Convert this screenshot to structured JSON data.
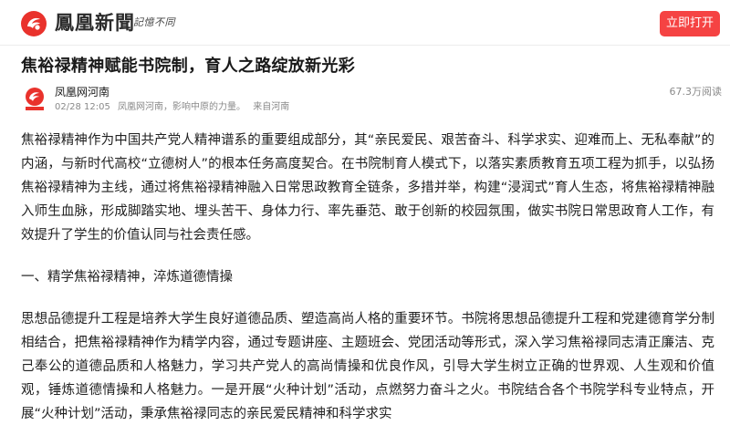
{
  "header": {
    "brand": "鳳凰新聞",
    "slogan": "記憶不同",
    "open_button": "立即打开"
  },
  "article": {
    "title": "焦裕禄精神赋能书院制，育人之路绽放新光彩",
    "author": "凤凰网河南",
    "date": "02/28 12:05",
    "source_desc": "凤凰网河南，影响中原的力量。",
    "origin": "来自河南",
    "reads": "67.3万阅读",
    "paragraph1": "焦裕禄精神作为中国共产党人精神谱系的重要组成部分，其“亲民爱民、艰苦奋斗、科学求实、迎难而上、无私奉献”的内涵，与新时代高校“立德树人”的根本任务高度契合。在书院制育人模式下，以落实素质教育五项工程为抓手，以弘扬焦裕禄精神为主线，通过将焦裕禄精神融入日常思政教育全链条，多措并举，构建“浸润式”育人生态，将焦裕禄精神融入师生血脉，形成脚踏实地、埋头苦干、身体力行、率先垂范、敢于创新的校园氛围，做实书院日常思政育人工作，有效提升了学生的价值认同与社会责任感。",
    "section1_title": "一、精学焦裕禄精神，淬炼道德情操",
    "paragraph2": "思想品德提升工程是培养大学生良好道德品质、塑造高尚人格的重要环节。书院将思想品德提升工程和党建德育学分制相结合，把焦裕禄精神作为精学内容，通过专题讲座、主题班会、党团活动等形式，深入学习焦裕禄同志清正廉洁、克己奉公的道德品质和人格魅力，学习共产党人的高尚情操和优良作风，引导大学生树立正确的世界观、人生观和价值观，锤炼道德情操和人格魅力。一是开展“火种计划”活动，点燃努力奋斗之火。书院结合各个书院学科专业特点，开展“火种计划”活动，秉承焦裕禄同志的亲民爱民精神和科学求实"
  },
  "colors": {
    "brand_red": "#e9322c",
    "button_red": "#f54343"
  }
}
